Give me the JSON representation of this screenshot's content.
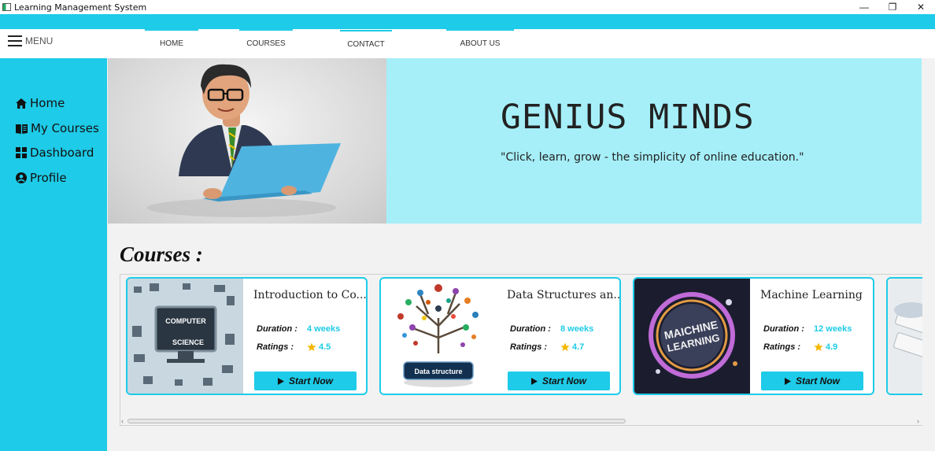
{
  "window": {
    "title": "Learning Management System",
    "minimize": "—",
    "restore": "❐",
    "close": "✕"
  },
  "topnav": {
    "menu_label": "MENU",
    "items": [
      {
        "label": "HOME"
      },
      {
        "label": "COURSES"
      },
      {
        "label": "CONTACT"
      },
      {
        "label": "ABOUT US"
      }
    ]
  },
  "sidebar": {
    "items": [
      {
        "label": "Home",
        "icon": "home-icon"
      },
      {
        "label": "My Courses",
        "icon": "book-icon"
      },
      {
        "label": "Dashboard",
        "icon": "dashboard-icon"
      },
      {
        "label": "Profile",
        "icon": "user-icon"
      }
    ]
  },
  "hero": {
    "title": "GENIUS MINDS",
    "subtitle": "\"Click, learn, grow - the simplicity of online education.\""
  },
  "courses": {
    "heading": "Courses :",
    "duration_label": "Duration :",
    "ratings_label": "Ratings :",
    "button_label": "Start Now",
    "items": [
      {
        "title": "Introduction to Co...",
        "duration": "4 weeks",
        "rating": "4.5",
        "image_text_1": "COMPUTER",
        "image_text_2": "SCIENCE"
      },
      {
        "title": "Data Structures an...",
        "duration": "8 weeks",
        "rating": "4.7",
        "image_text_1": "Data structure"
      },
      {
        "title": "Machine Learning",
        "duration": "12 weeks",
        "rating": "4.9",
        "image_text_1": "MAICHINE",
        "image_text_2": "LEARNING"
      }
    ]
  },
  "colors": {
    "accent": "#1ecbe8",
    "hero_bg": "#a6eff8"
  }
}
